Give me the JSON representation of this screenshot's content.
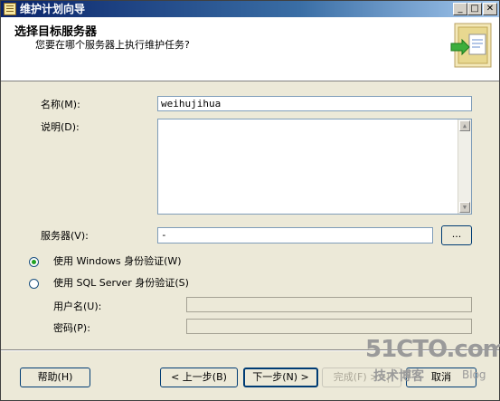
{
  "window": {
    "title": "维护计划向导"
  },
  "header": {
    "title": "选择目标服务器",
    "subtitle": "您要在哪个服务器上执行维护任务?"
  },
  "form": {
    "name_label": "名称(M):",
    "name_value": "weihujihua",
    "description_label": "说明(D):",
    "description_value": "",
    "server_label": "服务器(V):",
    "server_value": "-",
    "browse_label": "...",
    "auth_windows_label": "使用 Windows 身份验证(W)",
    "auth_sql_label": "使用 SQL Server 身份验证(S)",
    "auth_selected": "windows",
    "username_label": "用户名(U):",
    "username_value": "",
    "password_label": "密码(P):",
    "password_value": ""
  },
  "footer": {
    "help_label": "帮助(H)",
    "back_label": "< 上一步(B)",
    "next_label": "下一步(N) >",
    "finish_label": "完成(F) >>|",
    "cancel_label": "取消"
  },
  "watermark": {
    "site": "51CTO.com",
    "tagline": "技术博客",
    "blog": "Blog"
  }
}
